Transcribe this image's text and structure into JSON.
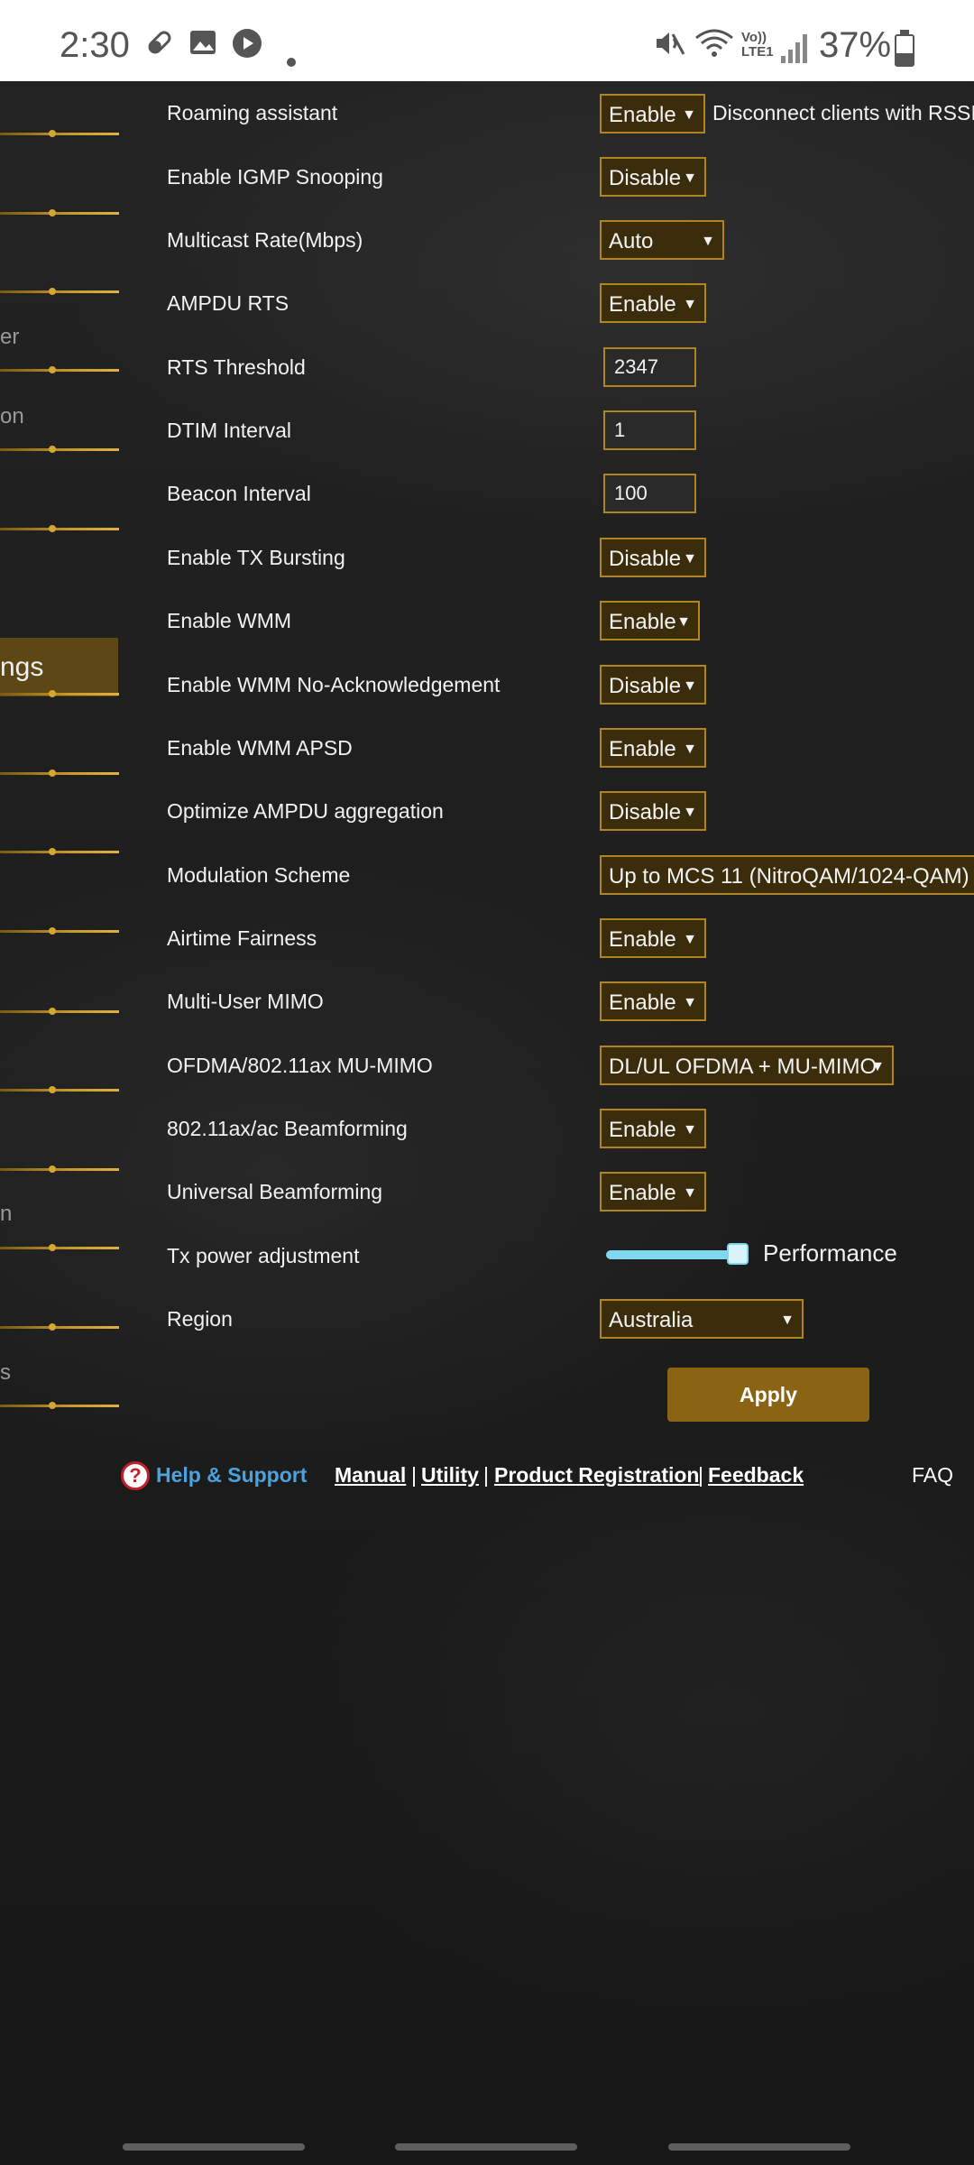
{
  "status_bar": {
    "time": "2:30",
    "icons": [
      "pill-icon",
      "image-icon",
      "play-icon",
      "dot-icon"
    ],
    "right_icons": [
      "mute-icon",
      "wifi-icon",
      "volte-icon",
      "signal-icon"
    ],
    "volte_label": "Vo))\nLTE1",
    "battery": "37%"
  },
  "sidebar": {
    "fragments": [
      "er",
      "on",
      "ngs",
      "n",
      "s"
    ]
  },
  "settings": {
    "roaming_assistant": {
      "label": "Roaming assistant",
      "value": "Enable",
      "note": "Disconnect clients with RSSI lo"
    },
    "igmp_snooping": {
      "label": "Enable IGMP Snooping",
      "value": "Disable"
    },
    "multicast_rate": {
      "label": "Multicast Rate(Mbps)",
      "value": "Auto"
    },
    "ampdu_rts": {
      "label": "AMPDU RTS",
      "value": "Enable"
    },
    "rts_threshold": {
      "label": "RTS Threshold",
      "value": "2347"
    },
    "dtim_interval": {
      "label": "DTIM Interval",
      "value": "1"
    },
    "beacon_interval": {
      "label": "Beacon Interval",
      "value": "100"
    },
    "tx_bursting": {
      "label": "Enable TX Bursting",
      "value": "Disable"
    },
    "wmm": {
      "label": "Enable WMM",
      "value": "Enable"
    },
    "wmm_noack": {
      "label": "Enable WMM No-Acknowledgement",
      "value": "Disable"
    },
    "wmm_apsd": {
      "label": "Enable WMM APSD",
      "value": "Enable"
    },
    "ampdu_agg": {
      "label": "Optimize AMPDU aggregation",
      "value": "Disable"
    },
    "modulation": {
      "label": "Modulation Scheme",
      "value": "Up to MCS 11 (NitroQAM/1024-QAM)"
    },
    "airtime": {
      "label": "Airtime Fairness",
      "value": "Enable"
    },
    "mu_mimo": {
      "label": "Multi-User MIMO",
      "value": "Enable"
    },
    "ofdma": {
      "label": "OFDMA/802.11ax MU-MIMO",
      "value": "DL/UL OFDMA + MU-MIMO"
    },
    "beamforming": {
      "label": "802.11ax/ac Beamforming",
      "value": "Enable"
    },
    "universal_beamforming": {
      "label": "Universal Beamforming",
      "value": "Enable"
    },
    "tx_power": {
      "label": "Tx power adjustment",
      "value_label": "Performance",
      "level_fraction": 1.0
    },
    "region": {
      "label": "Region",
      "value": "Australia"
    }
  },
  "apply_label": "Apply",
  "footer": {
    "help": "Help & Support",
    "links": [
      "Manual",
      "Utility",
      "Product Registration",
      "Feedback"
    ],
    "separator": "|",
    "faq": "FAQ"
  },
  "colors": {
    "accent": "#b08420",
    "select_bg": "#3b2c0b",
    "button": "#8a6413",
    "help_blue": "#4aa3e0",
    "slider": "#7fd8ee"
  }
}
